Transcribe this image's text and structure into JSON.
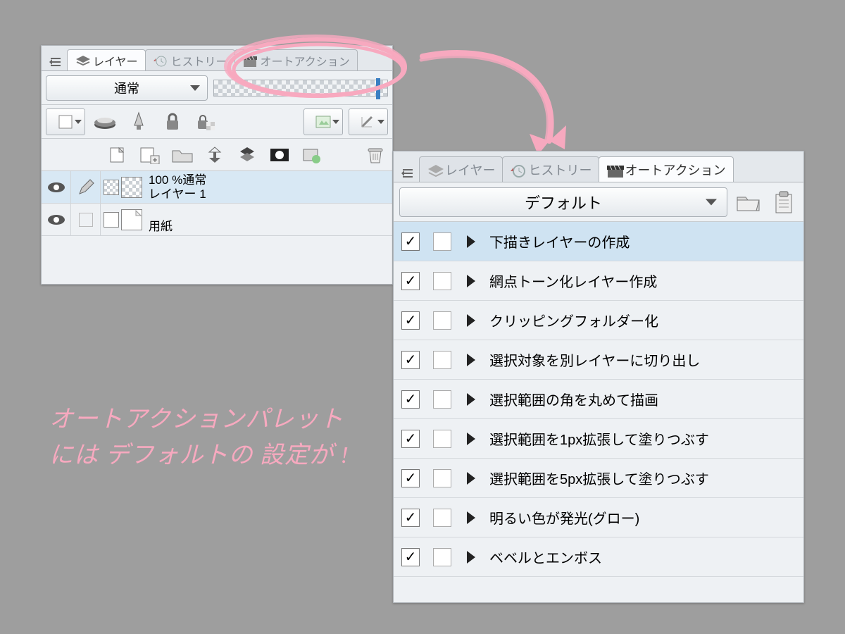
{
  "panelA": {
    "tabs": [
      {
        "label": "レイヤー",
        "active": true
      },
      {
        "label": "ヒストリー",
        "active": false
      },
      {
        "label": "オートアクション",
        "active": false
      }
    ],
    "blend_mode": "通常",
    "opacity_pct": 100,
    "layer1_opacity": "100 %通常",
    "layer1_name": "レイヤー 1",
    "layer2_name": "用紙"
  },
  "panelB": {
    "tabs": [
      {
        "label": "レイヤー",
        "active": false
      },
      {
        "label": "ヒストリー",
        "active": false
      },
      {
        "label": "オートアクション",
        "active": true
      }
    ],
    "set_name": "デフォルト",
    "actions": [
      {
        "checked": true,
        "label": "下描きレイヤーの作成",
        "selected": true
      },
      {
        "checked": true,
        "label": "網点トーン化レイヤー作成",
        "selected": false
      },
      {
        "checked": true,
        "label": "クリッピングフォルダー化",
        "selected": false
      },
      {
        "checked": true,
        "label": "選択対象を別レイヤーに切り出し",
        "selected": false
      },
      {
        "checked": true,
        "label": "選択範囲の角を丸めて描画",
        "selected": false
      },
      {
        "checked": true,
        "label": "選択範囲を1px拡張して塗りつぶす",
        "selected": false
      },
      {
        "checked": true,
        "label": "選択範囲を5px拡張して塗りつぶす",
        "selected": false
      },
      {
        "checked": true,
        "label": "明るい色が発光(グロー)",
        "selected": false
      },
      {
        "checked": true,
        "label": "ベベルとエンボス",
        "selected": false
      }
    ]
  },
  "annotation": {
    "line1": "オートアクションパレット",
    "line2": "には デフォルトの 設定が !"
  },
  "colors": {
    "accent": "#f7a9bf",
    "sel": "#cfe3f2"
  }
}
